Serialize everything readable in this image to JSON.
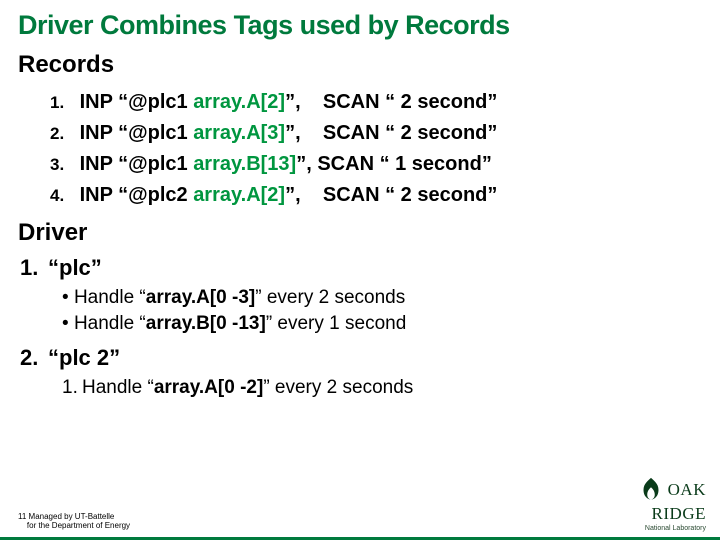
{
  "title": "Driver Combines Tags used by Records",
  "records_heading": "Records",
  "records": [
    {
      "n": "1.",
      "pre": "INP “@plc1 ",
      "arr": "array.A[2]",
      "post": "”,",
      "scan": "SCAN “ 2 second”"
    },
    {
      "n": "2.",
      "pre": "INP “@plc1 ",
      "arr": "array.A[3]",
      "post": "”,",
      "scan": "SCAN “ 2 second”"
    },
    {
      "n": "3.",
      "pre": "INP “@plc1 ",
      "arr": "array.B[13]",
      "post": "”,",
      "scan": "SCAN “ 1 second”"
    },
    {
      "n": "4.",
      "pre": "INP “@plc2 ",
      "arr": "array.A[2]",
      "post": "”,",
      "scan": "SCAN “ 2 second”"
    }
  ],
  "driver_heading": "Driver",
  "driver": [
    {
      "n": "1.",
      "label": "“plc”",
      "bullets": [
        {
          "pre": "Handle “",
          "arr": "array.A[0 -3]",
          "post": "” every 2 seconds"
        },
        {
          "pre": "Handle “",
          "arr": "array.B[0 -13]",
          "post": "” every 1 second"
        }
      ]
    },
    {
      "n": "2.",
      "label": "“plc 2”",
      "sub": [
        {
          "n": "1.",
          "pre": "Handle “",
          "arr": "array.A[0 -2]",
          "post": "” every 2 seconds"
        }
      ]
    }
  ],
  "footer": {
    "page": "11",
    "line1": "Managed by UT-Battelle",
    "line2": "for the Department of Energy"
  },
  "logo": {
    "name": "OAK\nRIDGE",
    "sub": "National Laboratory"
  }
}
